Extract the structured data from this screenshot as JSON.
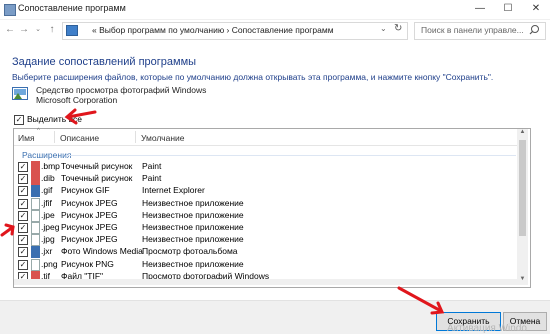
{
  "window": {
    "title": "Сопоставление программ",
    "minimize": "—",
    "maximize": "☐",
    "close": "✕"
  },
  "address": {
    "back": "←",
    "forward": "→",
    "up": "↑",
    "breadcrumb": "«  Выбор программ по умолчанию  ›  Сопоставление программ",
    "search_placeholder": "Поиск в панели управле..."
  },
  "content": {
    "heading": "Задание сопоставлений программы",
    "instructions": "Выберите расширения файлов, которые по умолчанию должна открывать эта программа, и нажмите кнопку \"Сохранить\".",
    "program_name": "Средство просмотра фотографий Windows",
    "program_corp": "Microsoft Corporation",
    "select_all": "Выделить все"
  },
  "list": {
    "columns": [
      "Имя",
      "Описание",
      "Умолчание"
    ],
    "group": "Расширения",
    "rows": [
      {
        "ext": ".bmp",
        "desc": "Точечный рисунок",
        "prog": "Paint",
        "checked": true
      },
      {
        "ext": ".dib",
        "desc": "Точечный рисунок",
        "prog": "Paint",
        "checked": true
      },
      {
        "ext": ".gif",
        "desc": "Рисунок GIF",
        "prog": "Internet Explorer",
        "checked": true
      },
      {
        "ext": ".jfif",
        "desc": "Рисунок JPEG",
        "prog": "Неизвестное приложение",
        "checked": true
      },
      {
        "ext": ".jpe",
        "desc": "Рисунок JPEG",
        "prog": "Неизвестное приложение",
        "checked": true
      },
      {
        "ext": ".jpeg",
        "desc": "Рисунок JPEG",
        "prog": "Неизвестное приложение",
        "checked": true
      },
      {
        "ext": ".jpg",
        "desc": "Рисунок JPEG",
        "prog": "Неизвестное приложение",
        "checked": true
      },
      {
        "ext": ".jxr",
        "desc": "Фото Windows Media",
        "prog": "Просмотр фотоальбома",
        "checked": true
      },
      {
        "ext": ".png",
        "desc": "Рисунок PNG",
        "prog": "Неизвестное приложение",
        "checked": true
      },
      {
        "ext": ".tif",
        "desc": "Файл \"TIF\"",
        "prog": "Просмотр фотографий Windows",
        "checked": true
      }
    ]
  },
  "footer": {
    "save": "Сохранить",
    "cancel": "Отмена",
    "watermark": "Активация Windo"
  },
  "colors": {
    "heading": "#1f3f8a",
    "group": "#3a6fb0",
    "annotation_arrow": "#e0161c",
    "primary_border": "#0078d7"
  }
}
